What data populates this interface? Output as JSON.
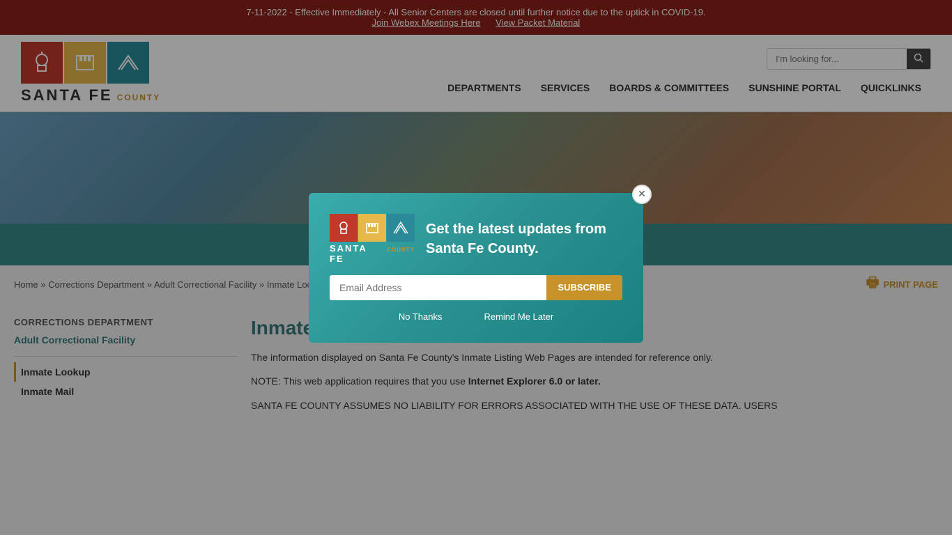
{
  "alert": {
    "message": "7-11-2022 - Effective Immediately - All Senior Centers are closed until further notice due to the uptick in COVID-19.",
    "link1_label": "Join Webex Meetings Here",
    "link2_label": "View Packet Material"
  },
  "header": {
    "logo_text": "SANTA FE",
    "logo_county": "COUNTY",
    "search_placeholder": "I'm looking for...",
    "nav": {
      "departments": "DEPARTMENTS",
      "services": "SERVICES",
      "boards": "BOARDS & COMMITTEES",
      "sunshine": "SUNSHINE PORTAL",
      "quicklinks": "QUICKLINKS"
    }
  },
  "breadcrumb": {
    "home": "Home",
    "sep1": "»",
    "link1": "Corrections Department",
    "sep2": "»",
    "link2": "Adult Correctional Facility",
    "sep3": "»",
    "current": "Inmate Lookup"
  },
  "print": {
    "label": "PRINT PAGE"
  },
  "sidebar": {
    "section_title": "CORRECTIONS DEPARTMENT",
    "main_link": "Adult Correctional Facility",
    "sub_links": [
      {
        "label": "Inmate Lookup",
        "active": true
      },
      {
        "label": "Inmate Mail",
        "active": false
      }
    ]
  },
  "page": {
    "title": "Inmate Lookup",
    "para1": "The information displayed on Santa Fe County's Inmate Listing Web Pages are intended for reference only.",
    "para2_prefix": "NOTE: This web application requires that you use ",
    "para2_bold": "Internet Explorer 6.0 or later.",
    "para3": "SANTA FE COUNTY ASSUMES NO LIABILITY FOR ERRORS ASSOCIATED WITH THE USE OF THESE DATA. USERS"
  },
  "modal": {
    "title": "Get the latest updates from Santa Fe County.",
    "email_placeholder": "Email Address",
    "subscribe_label": "SUBSCRIBE",
    "no_thanks": "No Thanks",
    "remind_later": "Remind Me Later",
    "logo_text": "SANTA FE",
    "logo_county": "COUNTY"
  }
}
